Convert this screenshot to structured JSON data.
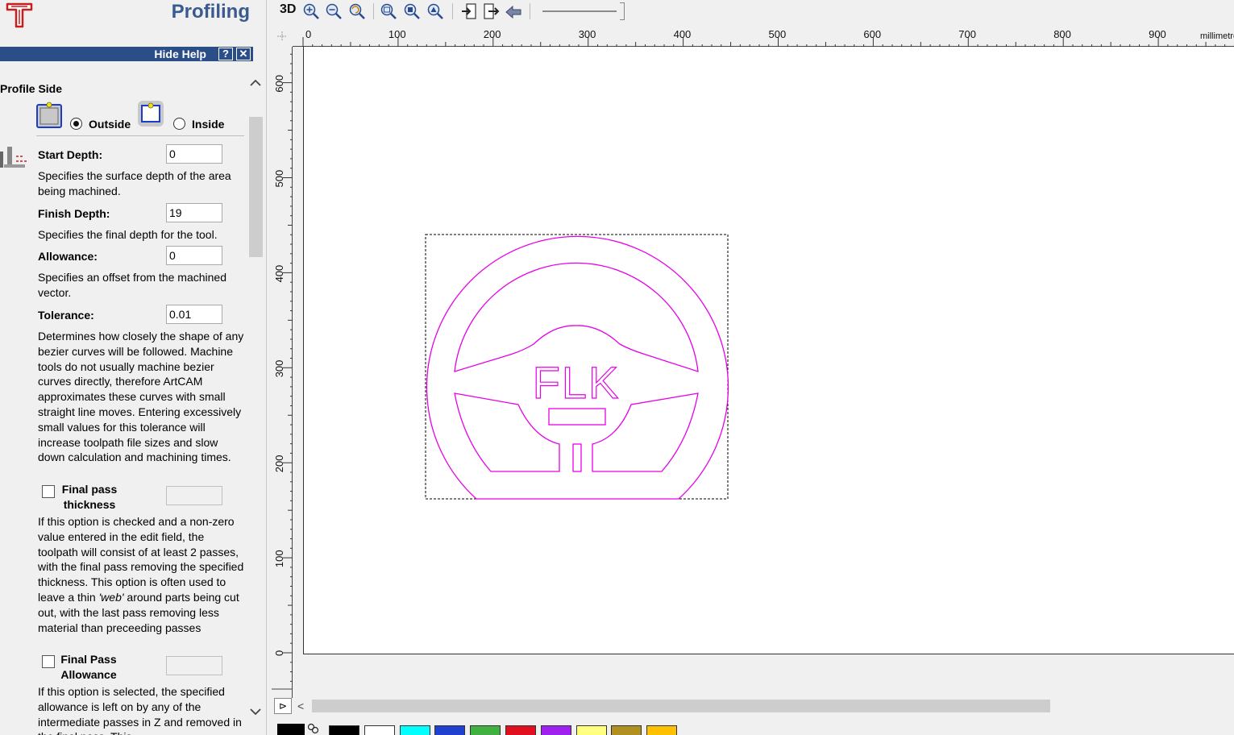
{
  "panel": {
    "title": "Profiling",
    "hide_help_label": "Hide Help",
    "help_question": "?",
    "help_close": "✕",
    "profile_side": {
      "heading": "Profile Side",
      "outside_label": "Outside",
      "inside_label": "Inside",
      "selected": "Outside"
    },
    "fields": {
      "start_depth": {
        "label": "Start Depth:",
        "value": "0",
        "help": "Specifies the surface depth of the area being machined."
      },
      "finish_depth": {
        "label": "Finish Depth:",
        "value": "19",
        "help": "Specifies the final depth for the tool."
      },
      "allowance": {
        "label": "Allowance:",
        "value": "0",
        "help": "Specifies an offset from the machined vector."
      },
      "tolerance": {
        "label": "Tolerance:",
        "value": "0.01",
        "help": "Determines how closely the shape of any bezier curves will be followed. Machine tools do not usually machine bezier curves directly, therefore ArtCAM approximates these curves with small straight line moves. Entering excessively small values for this tolerance will increase toolpath file sizes and slow down calculation and machining times."
      }
    },
    "final_pass_thickness": {
      "label_line1": "Final pass",
      "label_line2": "thickness",
      "value": "",
      "checked": false,
      "help_before": "If this option is checked and a non-zero value entered in the edit field, the toolpath will consist of at least 2 passes, with the final pass removing the specified thickness. This option is often used to leave a thin ",
      "help_em": "'web'",
      "help_after": " around parts being cut out, with the last pass removing less material than preceeding passes"
    },
    "final_pass_allowance": {
      "label_line1": "Final Pass",
      "label_line2": "Allowance",
      "value": "",
      "checked": false,
      "help": "If this option is selected, the specified allowance is left on by any of the intermediate passes in Z and removed in the final pass. This"
    }
  },
  "toolbar": {
    "view_3d_label": "3D",
    "buttons": [
      "zoom-in-icon",
      "zoom-out-icon",
      "zoom-previous-icon",
      "zoom-all-icon",
      "zoom-selection-icon",
      "zoom-model-icon",
      "import-icon",
      "export-icon",
      "undo-view-icon"
    ],
    "zoom_slider_value": 1.0
  },
  "ruler": {
    "unit_label": "millimetres",
    "x_ticks": [
      "0",
      "100",
      "200",
      "300",
      "400",
      "500",
      "600",
      "700",
      "800",
      "900"
    ],
    "y_ticks": [
      "600",
      "500",
      "400",
      "300",
      "200",
      "100",
      "0"
    ]
  },
  "canvas": {
    "vector_color": "#e600e6",
    "text": "FLK"
  },
  "palette": {
    "current": "#000000",
    "colors": [
      "#000000",
      "#ffffff",
      "#00ffff",
      "#2040d0",
      "#40b040",
      "#e01020",
      "#a020f0",
      "#ffff80",
      "#b09020",
      "#ffc000"
    ]
  }
}
